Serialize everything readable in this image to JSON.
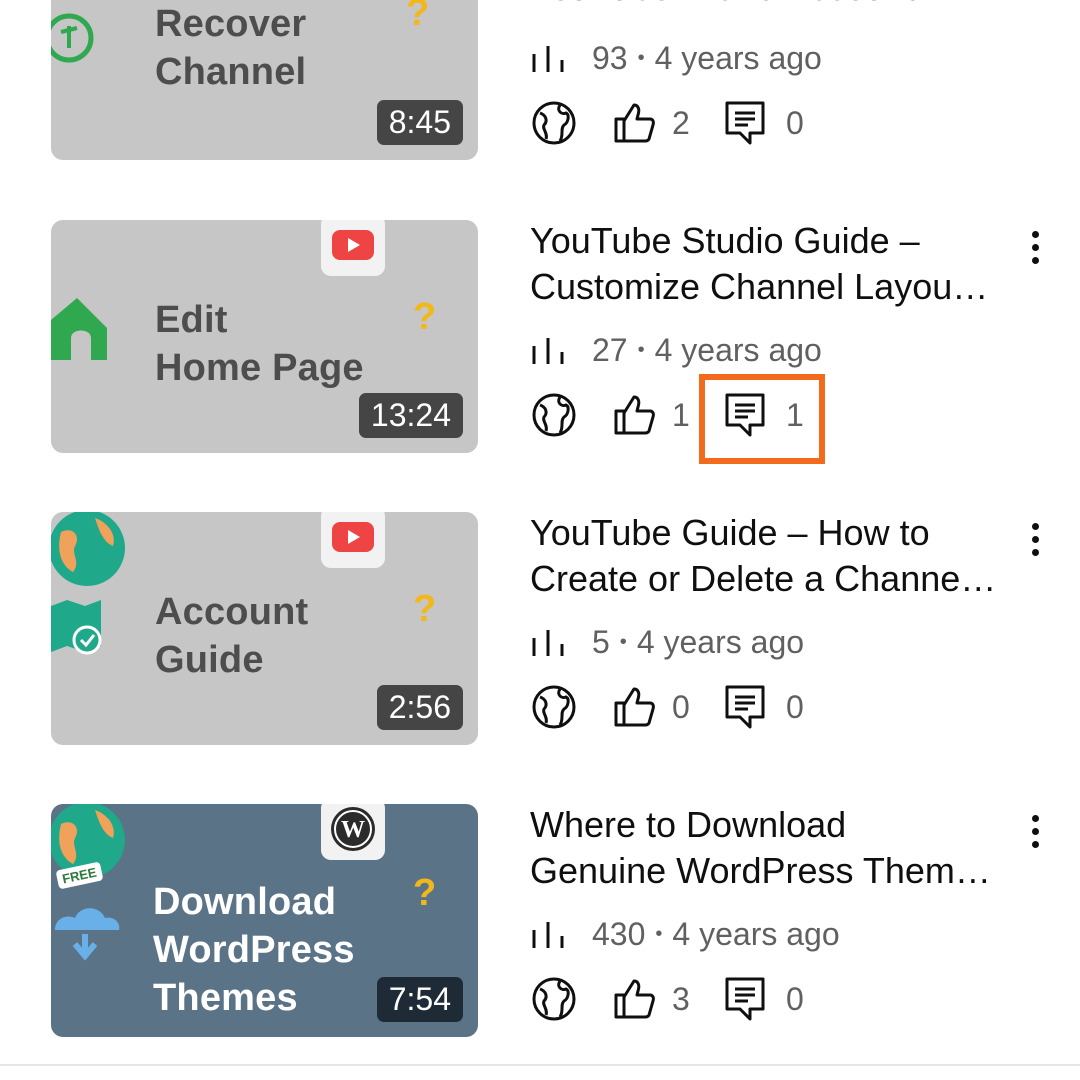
{
  "colors": {
    "accent_highlight": "#f26a1b",
    "thumb_gray": "#c6c6c6",
    "thumb_blue": "#5b7387",
    "youtube_red": "#ef4444",
    "question_yellow": "#f2b81b",
    "text_secondary": "#606060"
  },
  "videos": [
    {
      "thumb_lines": [
        "Recover",
        "Channel"
      ],
      "duration": "8:45",
      "title_line1": "YouTube Brand Account ...",
      "title_line2": "",
      "views": "93",
      "age": "4 years ago",
      "likes": "2",
      "comments": "0"
    },
    {
      "thumb_lines": [
        "Edit",
        "Home Page"
      ],
      "duration": "13:24",
      "title_line1": "YouTube Studio Guide –",
      "title_line2": "Customize Channel Layou…",
      "views": "27",
      "age": "4 years ago",
      "likes": "1",
      "comments": "1"
    },
    {
      "thumb_lines": [
        "Account",
        "Guide"
      ],
      "duration": "2:56",
      "title_line1": "YouTube Guide – How to",
      "title_line2": "Create or Delete a Channe…",
      "views": "5",
      "age": "4 years ago",
      "likes": "0",
      "comments": "0"
    },
    {
      "thumb_lines": [
        "Download",
        "WordPress",
        "Themes"
      ],
      "badge_text": "FREE",
      "duration": "7:54",
      "title_line1": "Where to Download",
      "title_line2": "Genuine WordPress Them…",
      "views": "430",
      "age": "4 years ago",
      "likes": "3",
      "comments": "0"
    }
  ],
  "icons": {
    "views": "bar-chart-icon",
    "visibility": "globe-icon",
    "likes": "thumbs-up-icon",
    "comments": "comment-icon",
    "menu": "more-vertical-icon"
  }
}
